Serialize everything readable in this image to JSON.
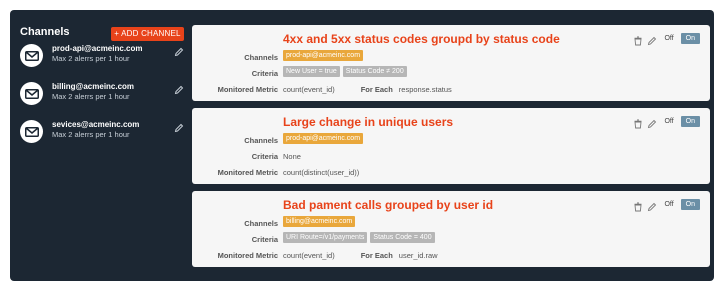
{
  "sidebar": {
    "title": "Channels",
    "add_button": "+ ADD CHANNEL",
    "channels": [
      {
        "email": "prod-api@acmeinc.com",
        "limit": "Max 2 alerrs per 1 hour"
      },
      {
        "email": "billing@acmeinc.com",
        "limit": "Max 2 alerrs per 1 hour"
      },
      {
        "email": "sevices@acmeinc.com",
        "limit": "Max 2 alerrs per 1 hour"
      }
    ]
  },
  "labels": {
    "channels": "Channels",
    "criteria": "Criteria",
    "metric": "Monitored Metric",
    "for_each": "For Each",
    "off": "Off",
    "on": "On"
  },
  "alerts": [
    {
      "title": "4xx and 5xx status codes groupd by status code",
      "channels": [
        "prod-api@acmeinc.com"
      ],
      "criteria": [
        "New User = true",
        "Status Code ≠ 200"
      ],
      "criteria_text": "",
      "metric": "count(event_id)",
      "for_each": "response.status"
    },
    {
      "title": "Large change in unique users",
      "channels": [
        "prod-api@acmeinc.com"
      ],
      "criteria": [],
      "criteria_text": "None",
      "metric": "count(distinct(user_id))",
      "for_each": ""
    },
    {
      "title": "Bad pament calls grouped by user id",
      "channels": [
        "billing@acmeinc.com"
      ],
      "criteria": [
        "URI Route=/v1/payments",
        "Status Code = 400"
      ],
      "criteria_text": "",
      "metric": "count(event_id)",
      "for_each": "user_id.raw"
    }
  ],
  "icons": {
    "channel": "envelope-icon",
    "edit": "pencil-icon",
    "delete": "trash-icon"
  },
  "colors": {
    "panel": "#1c2733",
    "accent": "#e8431a",
    "channel_tag": "#e9a73b",
    "criteria_tag": "#b6b6b6",
    "toggle_on": "#6b8fa6"
  }
}
